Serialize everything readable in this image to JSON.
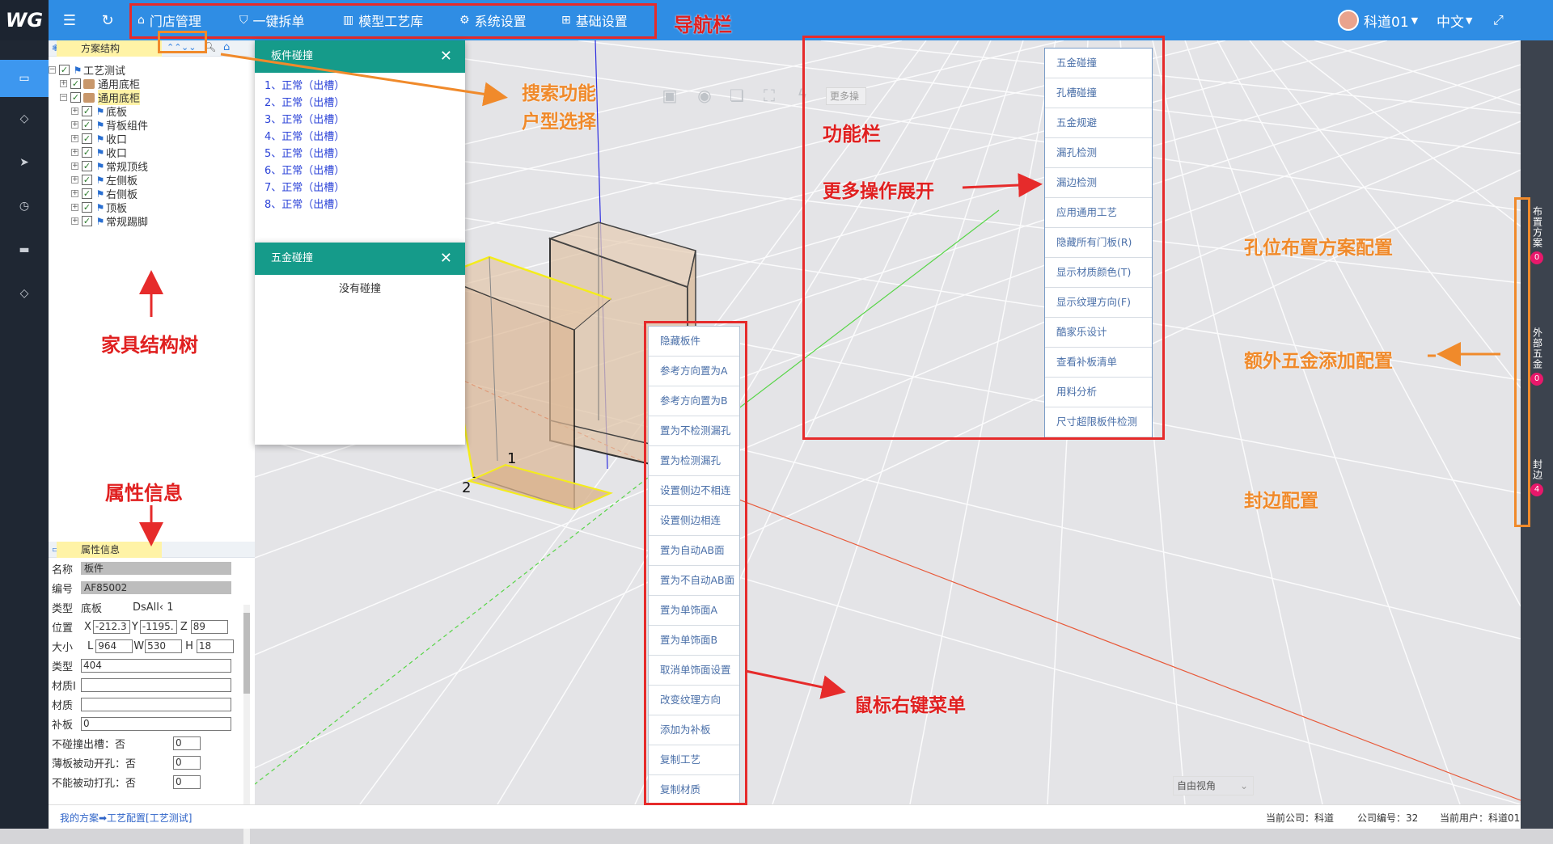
{
  "app": {
    "logo": "WG"
  },
  "topbar": {
    "nav": [
      {
        "label": "门店管理",
        "icon": "home-icon"
      },
      {
        "label": "一键拆单",
        "icon": "shield-icon"
      },
      {
        "label": "模型工艺库",
        "icon": "library-icon"
      },
      {
        "label": "系统设置",
        "icon": "gear-icon"
      },
      {
        "label": "基础设置",
        "icon": "grid-icon"
      }
    ],
    "user": "科道01",
    "language": "中文"
  },
  "tree_panel": {
    "title": "方案结构",
    "items": [
      {
        "label": "工艺测试",
        "level": 0,
        "icon": "flag"
      },
      {
        "label": "通用底柜",
        "level": 1,
        "icon": "folder"
      },
      {
        "label": "通用底柜",
        "level": 1,
        "icon": "folder",
        "selected": true
      },
      {
        "label": "底板",
        "level": 2,
        "icon": "flag"
      },
      {
        "label": "背板组件",
        "level": 2,
        "icon": "flag"
      },
      {
        "label": "收口",
        "level": 2,
        "icon": "flag"
      },
      {
        "label": "收口",
        "level": 2,
        "icon": "flag"
      },
      {
        "label": "常规顶线",
        "level": 2,
        "icon": "flag"
      },
      {
        "label": "左侧板",
        "level": 2,
        "icon": "flag"
      },
      {
        "label": "右侧板",
        "level": 2,
        "icon": "flag"
      },
      {
        "label": "顶板",
        "level": 2,
        "icon": "flag"
      },
      {
        "label": "常规踢脚",
        "level": 2,
        "icon": "flag"
      }
    ]
  },
  "props_panel": {
    "title": "属性信息",
    "name_label": "名称",
    "name_value": "板件",
    "code_label": "编号",
    "code_value": "AF85002",
    "type_label": "类型",
    "type_value": "底板",
    "dsall": "DsAll‹ 1",
    "pos_label": "位置",
    "x_label": "X",
    "x": "-212.3",
    "y_label": "Y",
    "y": "-1195.",
    "z_label": "Z",
    "z": "89",
    "size_label": "大小",
    "l_label": "L",
    "l": "964",
    "w_label": "W",
    "w": "530",
    "h_label": "H",
    "h": "18",
    "kind_label": "类型",
    "kind_value": "404",
    "matid_label": "材质I",
    "matid_value": "",
    "mat_label": "材质",
    "mat_value": "",
    "patch_label": "补板",
    "patch_value": "0",
    "flags": [
      {
        "label": "不碰撞出槽：否",
        "value": "0"
      },
      {
        "label": "薄板被动开孔：否",
        "value": "0"
      },
      {
        "label": "不能被动打孔：否",
        "value": "0"
      }
    ]
  },
  "collision_popup": {
    "title": "板件碰撞",
    "items": [
      "1、正常（出槽）",
      "2、正常（出槽）",
      "3、正常（出槽）",
      "4、正常（出槽）",
      "5、正常（出槽）",
      "6、正常（出槽）",
      "7、正常（出槽）",
      "8、正常（出槽）"
    ]
  },
  "hardware_popup": {
    "title": "五金碰撞",
    "empty": "没有碰撞"
  },
  "toolbar": {
    "more": "更多操"
  },
  "more_menu": [
    "五金碰撞",
    "孔槽碰撞",
    "五金规避",
    "漏孔检测",
    "漏边检测",
    "应用通用工艺",
    "隐藏所有门板(R)",
    "显示材质颜色(T)",
    "显示纹理方向(F)",
    "酷家乐设计",
    "查看补板清单",
    "用料分析",
    "尺寸超限板件检测"
  ],
  "context_menu": [
    "隐藏板件",
    "参考方向置为A",
    "参考方向置为B",
    "置为不检测漏孔",
    "置为检测漏孔",
    "设置侧边不相连",
    "设置侧边相连",
    "置为自动AB面",
    "置为不自动AB面",
    "置为单饰面A",
    "置为单饰面B",
    "取消单饰面设置",
    "改变纹理方向",
    "添加为补板",
    "复制工艺",
    "复制材质"
  ],
  "scene": {
    "label1": "1",
    "label2": "2",
    "view_mode": "自由视角"
  },
  "right_bar": [
    {
      "label": "布置方案",
      "count": "0"
    },
    {
      "label": "外部五金",
      "count": "0"
    },
    {
      "label": "封边",
      "count": "4"
    }
  ],
  "status": {
    "breadcrumb": "我的方案➡工艺配置[工艺测试]",
    "company": "当前公司：科道",
    "company_no": "公司编号：32",
    "user": "当前用户：科道01"
  },
  "annotations": {
    "navbar": "导航栏",
    "search": "搜索功能",
    "house": "户型选择",
    "func": "功能栏",
    "more": "更多操作展开",
    "tree": "家具结构树",
    "props": "属性信息",
    "rightclick": "鼠标右键菜单",
    "hole": "孔位布置方案配置",
    "extra": "额外五金添加配置",
    "edge": "封边配置"
  }
}
